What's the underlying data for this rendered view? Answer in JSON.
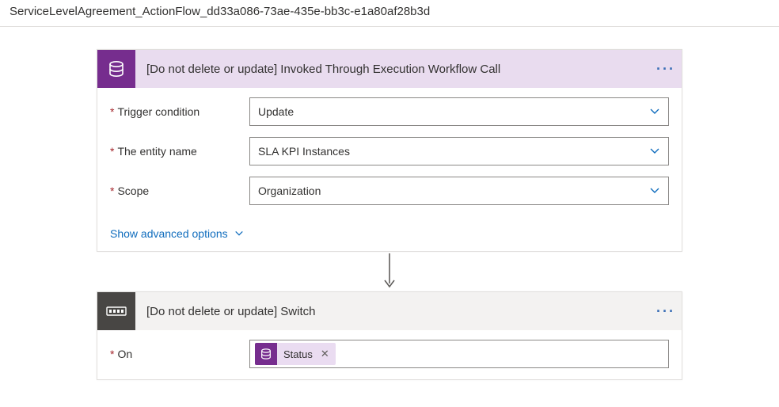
{
  "page_title": "ServiceLevelAgreement_ActionFlow_dd33a086-73ae-435e-bb3c-e1a80af28b3d",
  "trigger_card": {
    "title": "[Do not delete or update] Invoked Through Execution Workflow Call",
    "fields": {
      "trigger_condition": {
        "label": "Trigger condition",
        "value": "Update"
      },
      "entity_name": {
        "label": "The entity name",
        "value": "SLA KPI Instances"
      },
      "scope": {
        "label": "Scope",
        "value": "Organization"
      }
    },
    "advanced_link": "Show advanced options"
  },
  "switch_card": {
    "title": "[Do not delete or update] Switch",
    "on_label": "On",
    "token_label": "Status"
  }
}
